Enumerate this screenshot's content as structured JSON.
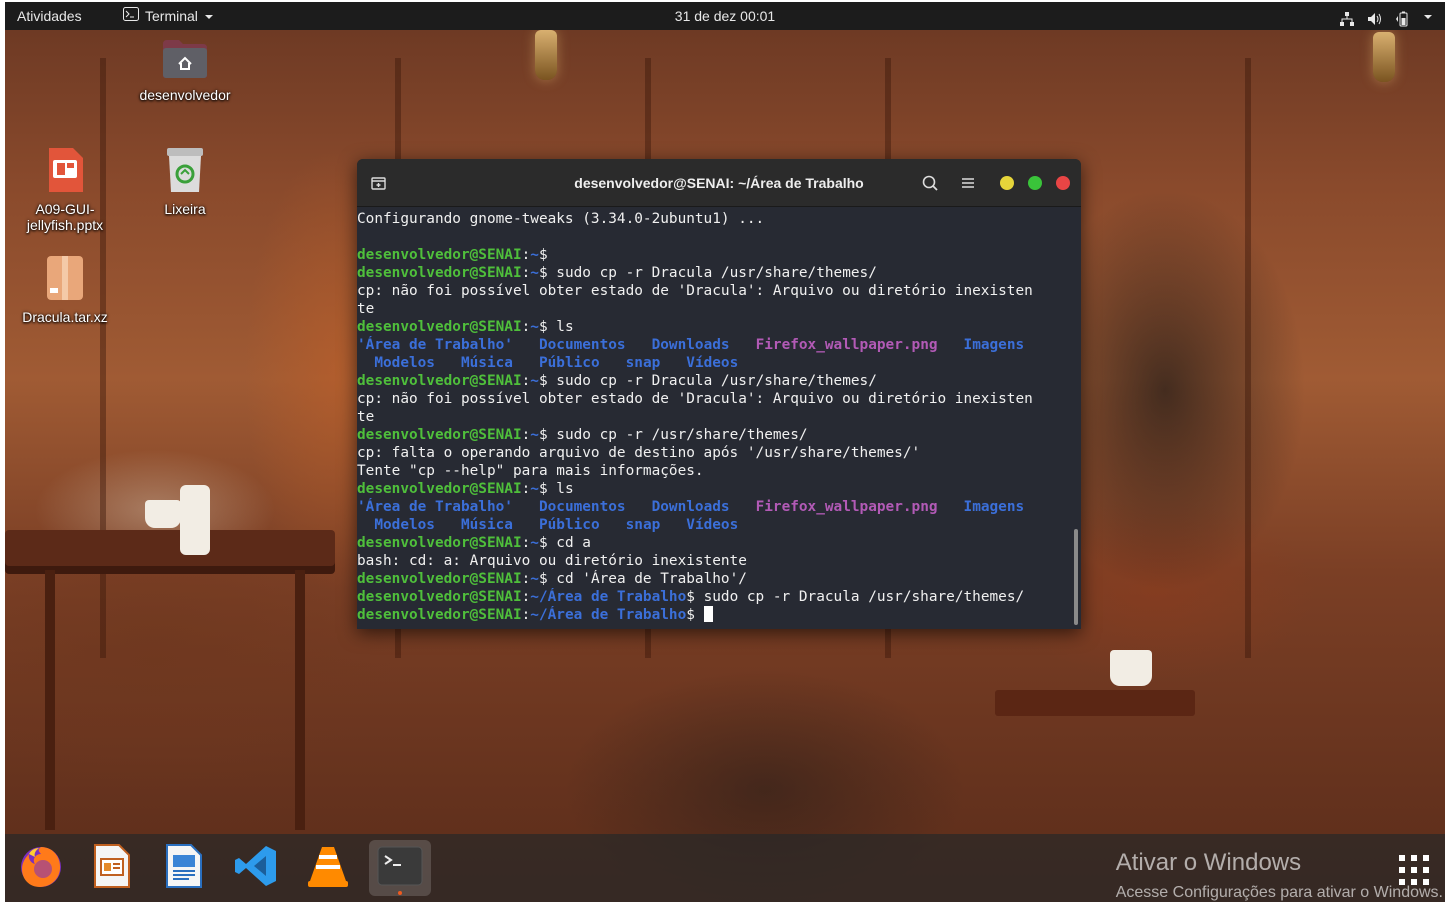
{
  "topbar": {
    "activities": "Atividades",
    "app_menu": "Terminal",
    "clock": "31 de dez  00:01"
  },
  "desktop_icons": [
    {
      "label": "desenvolvedor",
      "icon": "home-folder-icon"
    },
    {
      "label": "A09-GUI-jellyfish.pptx",
      "icon": "presentation-file-icon"
    },
    {
      "label": "Lixeira",
      "icon": "trash-icon"
    },
    {
      "label": "Dracula.tar.xz",
      "icon": "archive-file-icon"
    }
  ],
  "terminal": {
    "title": "desenvolvedor@SENAI: ~/Área de Trabalho",
    "prompt_user": "desenvolvedor@SENAI",
    "prompt_home": "~",
    "prompt_dir": "~/Área de Trabalho",
    "ls_items": [
      "'Área de Trabalho'",
      "Documentos",
      "Downloads",
      "Firefox_wallpaper.png",
      "Imagens",
      "Modelos",
      "Música",
      "Público",
      "snap",
      "Vídeos"
    ],
    "lines": {
      "l1": "Configurando gnome-tweaks (3.34.0-2ubuntu1) ...",
      "c2": "sudo cp -r Dracula /usr/share/themes/",
      "o2a": "cp: não foi possível obter estado de 'Dracula': Arquivo ou diretório inexisten",
      "o2b": "te",
      "c3": "ls",
      "c4": "sudo cp -r Dracula /usr/share/themes/",
      "o4a": "cp: não foi possível obter estado de 'Dracula': Arquivo ou diretório inexisten",
      "o4b": "te",
      "c5": "sudo cp -r /usr/share/themes/",
      "o5a": "cp: falta o operando arquivo de destino após '/usr/share/themes/'",
      "o5b": "Tente \"cp --help\" para mais informações.",
      "c6": "ls",
      "c7": "cd a",
      "o7": "bash: cd: a: Arquivo ou diretório inexistente",
      "c8": "cd 'Área de Trabalho'/",
      "c9": "sudo cp -r Dracula /usr/share/themes/"
    }
  },
  "dock": [
    {
      "name": "Firefox",
      "icon": "firefox-icon"
    },
    {
      "name": "Impress",
      "icon": "impress-icon"
    },
    {
      "name": "Writer",
      "icon": "writer-icon"
    },
    {
      "name": "Visual Studio Code",
      "icon": "vscode-icon"
    },
    {
      "name": "VLC",
      "icon": "vlc-icon"
    },
    {
      "name": "Terminal",
      "icon": "terminal-icon",
      "active": true
    }
  ],
  "watermark": {
    "line1": "Ativar o Windows",
    "line2": "Acesse Configurações para ativar o Windows."
  },
  "colors": {
    "prompt_user": "#4fbf3b",
    "prompt_path": "#3b6fd9",
    "directory": "#3b6fd9",
    "image_file": "#b25ab6",
    "close_button": "#e84545",
    "maximize_button": "#3ac43a",
    "minimize_button": "#e6d53a",
    "terminal_bg": "#272a33"
  }
}
